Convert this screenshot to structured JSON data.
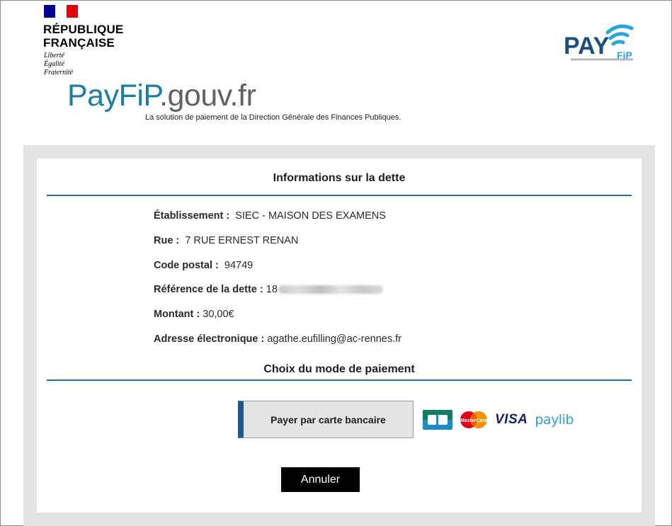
{
  "header": {
    "republic_line1": "RÉPUBLIQUE",
    "republic_line2": "FRANÇAISE",
    "motto_1": "Liberté",
    "motto_2": "Égalité",
    "motto_3": "Fraternité",
    "logo_main": "PAY",
    "logo_sub": "FiP",
    "brand_payfip": "PayFiP",
    "brand_domain": ".gouv.fr",
    "tagline": "La solution de paiement de la Direction Générale des Finances Publiques."
  },
  "debt_info": {
    "title": "Informations sur la dette",
    "fields": [
      {
        "label": "Établissement :",
        "value": "SIEC - MAISON DES EXAMENS"
      },
      {
        "label": "Rue :",
        "value": "7 RUE ERNEST RENAN"
      },
      {
        "label": "Code postal :",
        "value": "94749"
      },
      {
        "label": "Référence de la dette :",
        "value": "18"
      },
      {
        "label": "Montant :",
        "value": "30,00€"
      },
      {
        "label": "Adresse électronique :",
        "value": "agathe.eufilling@ac-rennes.fr"
      }
    ]
  },
  "payment": {
    "title": "Choix du mode de paiement",
    "card_button_label": "Payer par carte bancaire",
    "card_logos": [
      "cb-logo",
      "mastercard-logo",
      "visa-logo",
      "paylib-logo"
    ],
    "mastercard_text": "MasterCard",
    "visa_text": "VISA",
    "paylib_text": "paylib"
  },
  "actions": {
    "cancel_label": "Annuler"
  },
  "colors": {
    "accent_blue": "#1f6eaa",
    "brand_blue": "#1b7fa5",
    "marianne_blue": "#000091",
    "marianne_red": "#e1000f"
  }
}
